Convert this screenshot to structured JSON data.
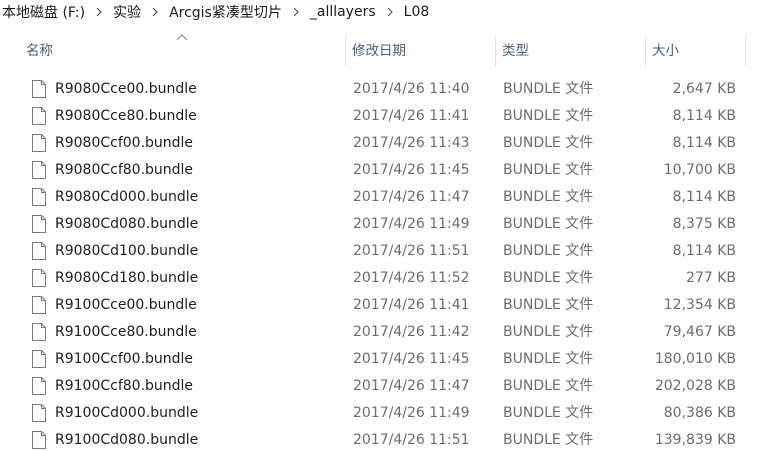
{
  "breadcrumb": [
    "本地磁盘 (F:)",
    "实验",
    "Arcgis紧凑型切片",
    "_alllayers",
    "L08"
  ],
  "columns": {
    "name": "名称",
    "date": "修改日期",
    "type": "类型",
    "size": "大小"
  },
  "sort": {
    "column": "name",
    "direction": "ascending",
    "icon": "sort-up-arrow-icon"
  },
  "files": [
    {
      "name": "R9080Cce00.bundle",
      "date": "2017/4/26 11:40",
      "type": "BUNDLE 文件",
      "size": "2,647 KB",
      "icon": "file-icon"
    },
    {
      "name": "R9080Cce80.bundle",
      "date": "2017/4/26 11:41",
      "type": "BUNDLE 文件",
      "size": "8,114 KB",
      "icon": "file-icon"
    },
    {
      "name": "R9080Ccf00.bundle",
      "date": "2017/4/26 11:43",
      "type": "BUNDLE 文件",
      "size": "8,114 KB",
      "icon": "file-icon"
    },
    {
      "name": "R9080Ccf80.bundle",
      "date": "2017/4/26 11:45",
      "type": "BUNDLE 文件",
      "size": "10,700 KB",
      "icon": "file-icon"
    },
    {
      "name": "R9080Cd000.bundle",
      "date": "2017/4/26 11:47",
      "type": "BUNDLE 文件",
      "size": "8,114 KB",
      "icon": "file-icon"
    },
    {
      "name": "R9080Cd080.bundle",
      "date": "2017/4/26 11:49",
      "type": "BUNDLE 文件",
      "size": "8,375 KB",
      "icon": "file-icon"
    },
    {
      "name": "R9080Cd100.bundle",
      "date": "2017/4/26 11:51",
      "type": "BUNDLE 文件",
      "size": "8,114 KB",
      "icon": "file-icon"
    },
    {
      "name": "R9080Cd180.bundle",
      "date": "2017/4/26 11:52",
      "type": "BUNDLE 文件",
      "size": "277 KB",
      "icon": "file-icon"
    },
    {
      "name": "R9100Cce00.bundle",
      "date": "2017/4/26 11:41",
      "type": "BUNDLE 文件",
      "size": "12,354 KB",
      "icon": "file-icon"
    },
    {
      "name": "R9100Cce80.bundle",
      "date": "2017/4/26 11:42",
      "type": "BUNDLE 文件",
      "size": "79,467 KB",
      "icon": "file-icon"
    },
    {
      "name": "R9100Ccf00.bundle",
      "date": "2017/4/26 11:45",
      "type": "BUNDLE 文件",
      "size": "180,010 KB",
      "icon": "file-icon"
    },
    {
      "name": "R9100Ccf80.bundle",
      "date": "2017/4/26 11:47",
      "type": "BUNDLE 文件",
      "size": "202,028 KB",
      "icon": "file-icon"
    },
    {
      "name": "R9100Cd000.bundle",
      "date": "2017/4/26 11:49",
      "type": "BUNDLE 文件",
      "size": "80,386 KB",
      "icon": "file-icon"
    },
    {
      "name": "R9100Cd080.bundle",
      "date": "2017/4/26 11:51",
      "type": "BUNDLE 文件",
      "size": "139,839 KB",
      "icon": "file-icon"
    }
  ]
}
